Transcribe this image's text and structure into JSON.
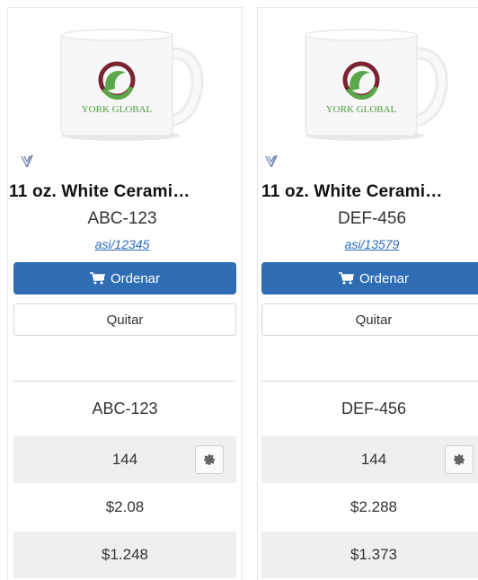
{
  "products": [
    {
      "name": "11 oz. White Cerami…",
      "sku": "ABC-123",
      "asi": "asi/12345",
      "order_label": "Ordenar",
      "remove_label": "Quitar",
      "compare_sku": "ABC-123",
      "quantity": "144",
      "price1": "$2.08",
      "price2": "$1.248",
      "mug_logo_text": "YORK GLOBAL"
    },
    {
      "name": "11 oz. White Cerami…",
      "sku": "DEF-456",
      "asi": "asi/13579",
      "order_label": "Ordenar",
      "remove_label": "Quitar",
      "compare_sku": "DEF-456",
      "quantity": "144",
      "price1": "$2.288",
      "price2": "$1.373",
      "mug_logo_text": "YORK GLOBAL"
    }
  ],
  "colors": {
    "primary": "#2e6db4",
    "link": "#2a6bbd",
    "row_shade": "#efefef",
    "logo_green": "#5aa84a",
    "logo_maroon": "#7a2432"
  },
  "icons": [
    "cart-icon",
    "gear-icon",
    "brand-badge-icon"
  ]
}
